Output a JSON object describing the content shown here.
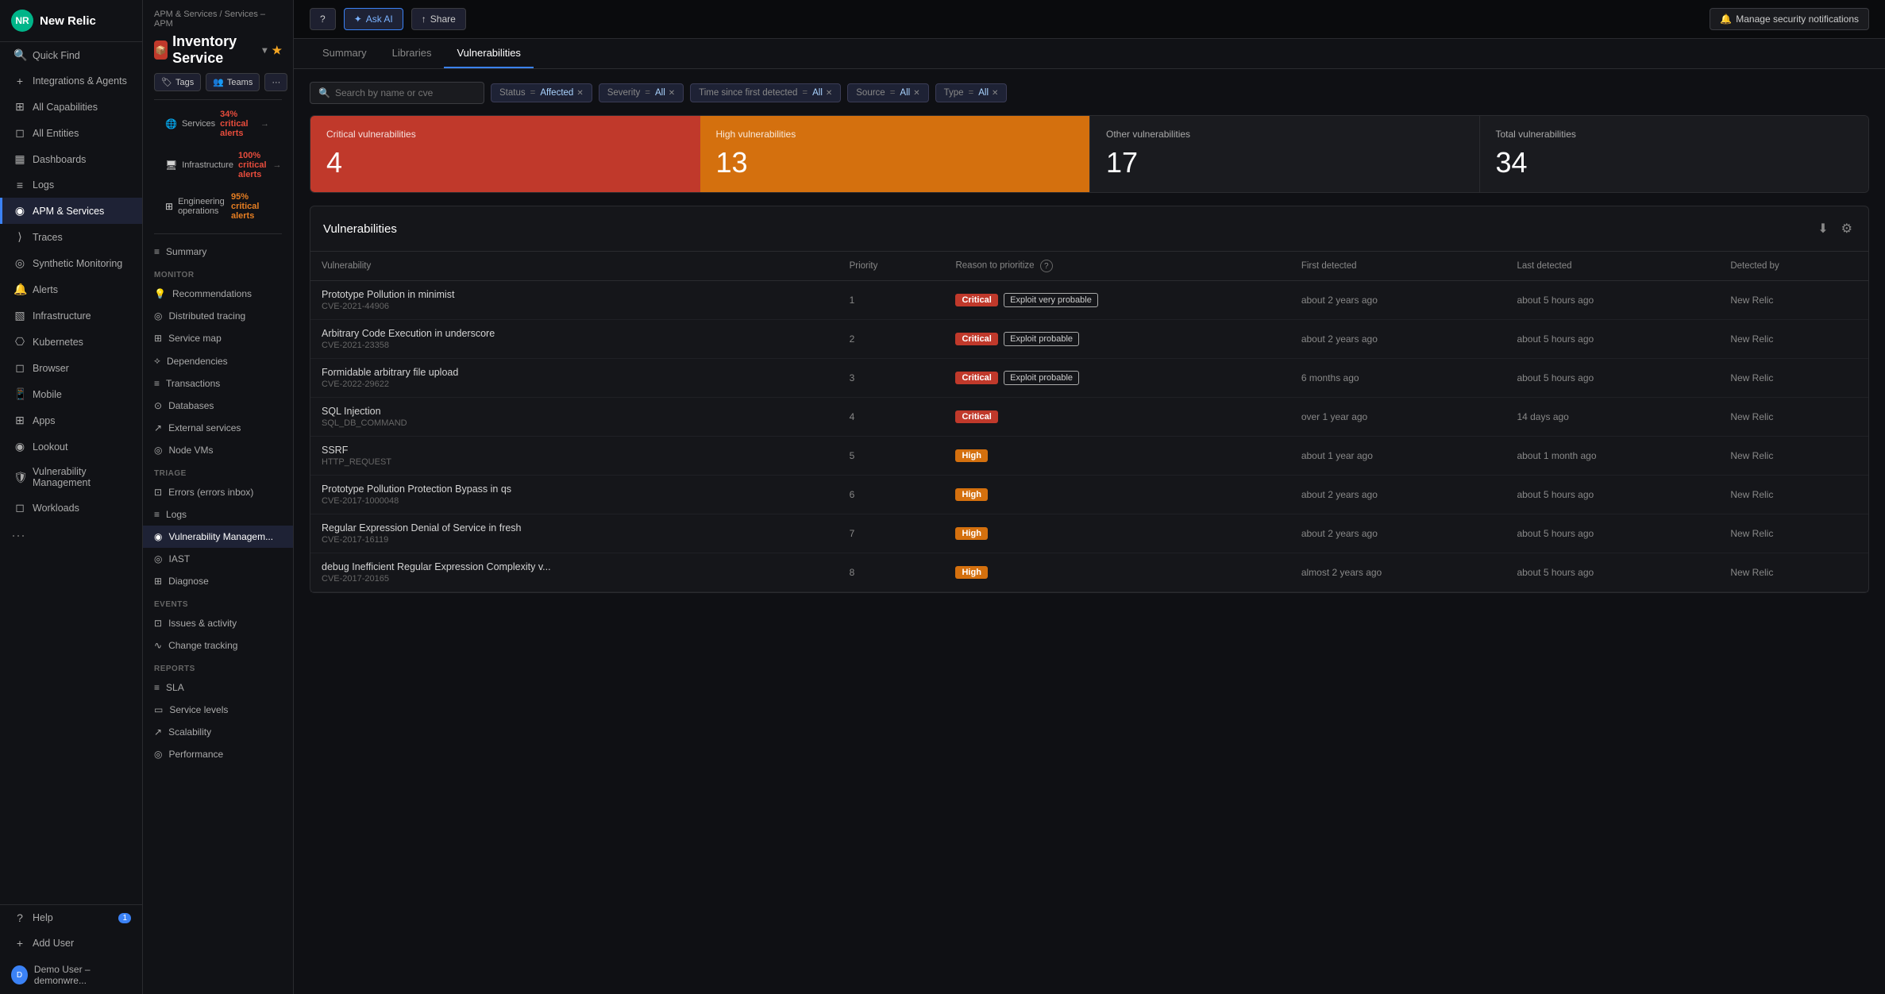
{
  "app": {
    "name": "New Relic"
  },
  "leftNav": {
    "items": [
      {
        "id": "quick-find",
        "label": "Quick Find",
        "icon": "🔍"
      },
      {
        "id": "integrations",
        "label": "Integrations & Agents",
        "icon": "+"
      },
      {
        "id": "all-capabilities",
        "label": "All Capabilities",
        "icon": "⊞"
      },
      {
        "id": "all-entities",
        "label": "All Entities",
        "icon": "◻"
      },
      {
        "id": "dashboards",
        "label": "Dashboards",
        "icon": "▦"
      },
      {
        "id": "logs",
        "label": "Logs",
        "icon": "≡"
      },
      {
        "id": "apm-services",
        "label": "APM & Services",
        "icon": "◉",
        "active": true
      },
      {
        "id": "traces",
        "label": "Traces",
        "icon": "⟩"
      },
      {
        "id": "synthetic",
        "label": "Synthetic Monitoring",
        "icon": "◎"
      },
      {
        "id": "alerts",
        "label": "Alerts",
        "icon": "🔔"
      },
      {
        "id": "infrastructure",
        "label": "Infrastructure",
        "icon": "▧"
      },
      {
        "id": "kubernetes",
        "label": "Kubernetes",
        "icon": "⎔"
      },
      {
        "id": "browser",
        "label": "Browser",
        "icon": "◻"
      },
      {
        "id": "mobile",
        "label": "Mobile",
        "icon": "📱"
      },
      {
        "id": "apps",
        "label": "Apps",
        "icon": "⊞"
      },
      {
        "id": "lookout",
        "label": "Lookout",
        "icon": "◉"
      },
      {
        "id": "vuln-mgmt",
        "label": "Vulnerability Management",
        "icon": "🛡"
      },
      {
        "id": "workloads",
        "label": "Workloads",
        "icon": "◻"
      }
    ],
    "bottom": [
      {
        "id": "help",
        "label": "Help",
        "badge": "1"
      },
      {
        "id": "add-user",
        "label": "Add User"
      },
      {
        "id": "demo-user",
        "label": "Demo User – demonwre..."
      }
    ]
  },
  "breadcrumb": "APM & Services / Services – APM",
  "serviceTitle": "Inventory Service",
  "serviceTabs": [
    {
      "id": "summary",
      "label": "Summary"
    },
    {
      "id": "libraries",
      "label": "Libraries"
    },
    {
      "id": "vulnerabilities",
      "label": "Vulnerabilities",
      "active": true
    }
  ],
  "serviceActions": [
    {
      "id": "tags",
      "label": "Tags",
      "icon": "🏷"
    },
    {
      "id": "teams",
      "label": "Teams",
      "icon": "👥"
    },
    {
      "id": "more",
      "label": "···"
    }
  ],
  "healthBars": [
    {
      "id": "services",
      "label": "Services",
      "value": "34% critical alerts",
      "type": "red"
    },
    {
      "id": "infrastructure",
      "label": "Infrastructure",
      "value": "100% critical alerts",
      "type": "red"
    },
    {
      "id": "engineering-ops",
      "label": "Engineering operations",
      "value": "95% critical alerts",
      "type": "orange"
    }
  ],
  "topRight": {
    "helpLabel": "?",
    "askAI": "Ask AI",
    "share": "Share",
    "manageNotifications": "Manage security notifications"
  },
  "mainTabs": {
    "summary": "Summary",
    "libraries": "Libraries",
    "vulnerabilities": "Vulnerabilities"
  },
  "filters": {
    "searchPlaceholder": "Search by name or cve",
    "chips": [
      {
        "key": "Status",
        "eq": "=",
        "value": "Affected"
      },
      {
        "key": "Severity",
        "eq": "=",
        "value": "All"
      },
      {
        "key": "Time since first detected",
        "eq": "=",
        "value": "All"
      },
      {
        "key": "Source",
        "eq": "=",
        "value": "All"
      },
      {
        "key": "Type",
        "eq": "=",
        "value": "All"
      }
    ]
  },
  "statCards": [
    {
      "id": "critical",
      "label": "Critical vulnerabilities",
      "value": "4",
      "type": "critical"
    },
    {
      "id": "high",
      "label": "High vulnerabilities",
      "value": "13",
      "type": "high"
    },
    {
      "id": "other",
      "label": "Other vulnerabilities",
      "value": "17",
      "type": "other"
    },
    {
      "id": "total",
      "label": "Total vulnerabilities",
      "value": "34",
      "type": "total"
    }
  ],
  "vulnTable": {
    "title": "Vulnerabilities",
    "columns": [
      "Vulnerability",
      "Priority",
      "Reason to prioritize",
      "First detected",
      "Last detected",
      "Detected by"
    ],
    "rows": [
      {
        "name": "Prototype Pollution in minimist",
        "cve": "CVE-2021-44906",
        "priority": 1,
        "severity": "Critical",
        "reason": "Exploit very probable",
        "firstDetected": "about 2 years ago",
        "lastDetected": "about 5 hours ago",
        "detectedBy": "New Relic"
      },
      {
        "name": "Arbitrary Code Execution in underscore",
        "cve": "CVE-2021-23358",
        "priority": 2,
        "severity": "Critical",
        "reason": "Exploit probable",
        "firstDetected": "about 2 years ago",
        "lastDetected": "about 5 hours ago",
        "detectedBy": "New Relic"
      },
      {
        "name": "Formidable arbitrary file upload",
        "cve": "CVE-2022-29622",
        "priority": 3,
        "severity": "Critical",
        "reason": "Exploit probable",
        "firstDetected": "6 months ago",
        "lastDetected": "about 5 hours ago",
        "detectedBy": "New Relic"
      },
      {
        "name": "SQL Injection",
        "cve": "SQL_DB_COMMAND",
        "priority": 4,
        "severity": "Critical",
        "reason": "",
        "firstDetected": "over 1 year ago",
        "lastDetected": "14 days ago",
        "detectedBy": "New Relic"
      },
      {
        "name": "SSRF",
        "cve": "HTTP_REQUEST",
        "priority": 5,
        "severity": "High",
        "reason": "",
        "firstDetected": "about 1 year ago",
        "lastDetected": "about 1 month ago",
        "detectedBy": "New Relic"
      },
      {
        "name": "Prototype Pollution Protection Bypass in qs",
        "cve": "CVE-2017-1000048",
        "priority": 6,
        "severity": "High",
        "reason": "",
        "firstDetected": "about 2 years ago",
        "lastDetected": "about 5 hours ago",
        "detectedBy": "New Relic"
      },
      {
        "name": "Regular Expression Denial of Service in fresh",
        "cve": "CVE-2017-16119",
        "priority": 7,
        "severity": "High",
        "reason": "",
        "firstDetected": "about 2 years ago",
        "lastDetected": "about 5 hours ago",
        "detectedBy": "New Relic"
      },
      {
        "name": "debug Inefficient Regular Expression Complexity v...",
        "cve": "CVE-2017-20165",
        "priority": 8,
        "severity": "High",
        "reason": "",
        "firstDetected": "almost 2 years ago",
        "lastDetected": "about 5 hours ago",
        "detectedBy": "New Relic"
      }
    ]
  },
  "secondaryNav": {
    "monitor": {
      "title": "MONITOR",
      "items": [
        {
          "id": "recommendations",
          "label": "Recommendations",
          "icon": "💡"
        },
        {
          "id": "distributed-tracing",
          "label": "Distributed tracing",
          "icon": "◎"
        },
        {
          "id": "service-map",
          "label": "Service map",
          "icon": "⊞"
        },
        {
          "id": "dependencies",
          "label": "Dependencies",
          "icon": "⟡"
        },
        {
          "id": "transactions",
          "label": "Transactions",
          "icon": "≡"
        },
        {
          "id": "databases",
          "label": "Databases",
          "icon": "⊙"
        },
        {
          "id": "external-services",
          "label": "External services",
          "icon": "↗"
        },
        {
          "id": "node-vms",
          "label": "Node VMs",
          "icon": "◎"
        }
      ]
    },
    "triage": {
      "title": "TRIAGE",
      "items": [
        {
          "id": "errors-inbox",
          "label": "Errors (errors inbox)",
          "icon": "⊡"
        },
        {
          "id": "logs-triage",
          "label": "Logs",
          "icon": "≡"
        },
        {
          "id": "vuln-mgmt-nav",
          "label": "Vulnerability Managem...",
          "icon": "◉",
          "active": true
        }
      ]
    },
    "settings": {
      "items": [
        {
          "id": "iast",
          "label": "IAST",
          "icon": "◎"
        },
        {
          "id": "diagnose",
          "label": "Diagnose",
          "icon": "⊞"
        }
      ]
    },
    "events": {
      "title": "EVENTS",
      "items": [
        {
          "id": "issues-activity",
          "label": "Issues & activity",
          "icon": "⊡"
        },
        {
          "id": "change-tracking",
          "label": "Change tracking",
          "icon": "∿"
        }
      ]
    },
    "reports": {
      "title": "REPORTS",
      "items": [
        {
          "id": "sla",
          "label": "SLA",
          "icon": "≡"
        },
        {
          "id": "service-levels",
          "label": "Service levels",
          "icon": "▭"
        },
        {
          "id": "scalability",
          "label": "Scalability",
          "icon": "↗"
        },
        {
          "id": "performance",
          "label": "Performance",
          "icon": "◎"
        }
      ]
    }
  }
}
